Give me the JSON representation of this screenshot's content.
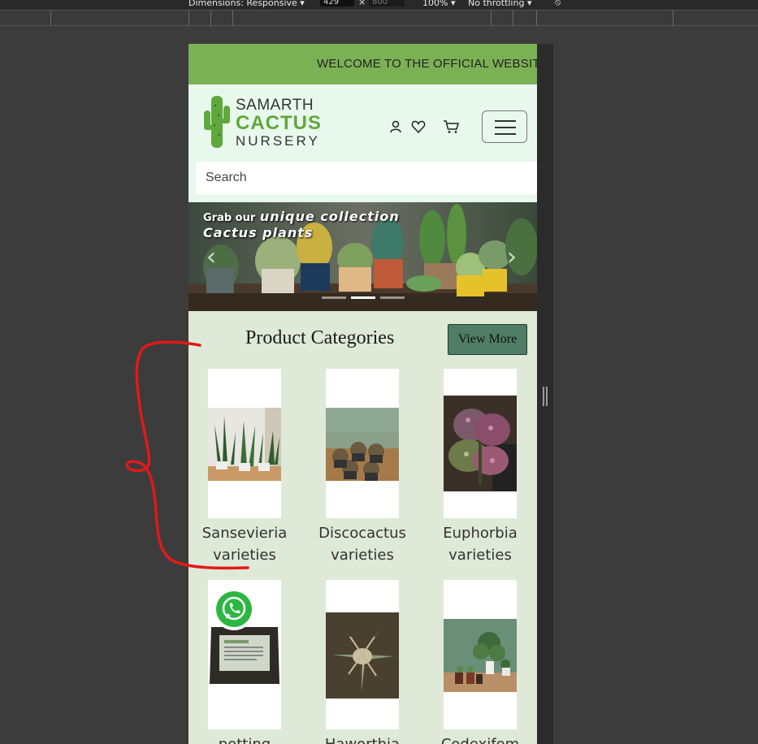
{
  "devtools": {
    "dimensions_label": "Dimensions: Responsive",
    "width_value": "429",
    "height_value": "800",
    "zoom_label": "100%",
    "throttle_label": "No throttling"
  },
  "site": {
    "marquee": "WELCOME TO THE OFFICIAL WEBSITE",
    "logo": {
      "line1": "SAMARTH",
      "line2": "CACTUS",
      "line3": "NURSERY"
    },
    "search_placeholder": "Search",
    "banner": {
      "line1a": "Grab our",
      "line1b": "unique collection",
      "line2": "Cactus plants"
    },
    "categories_title": "Product Categories",
    "view_more_label": "View More",
    "categories": [
      {
        "label": "Sansevieria varieties"
      },
      {
        "label": "Discocactus varieties"
      },
      {
        "label": "Euphorbia varieties"
      },
      {
        "label": "potting"
      },
      {
        "label": "Haworthia"
      },
      {
        "label": "Codexifom"
      }
    ]
  },
  "colors": {
    "marquee_bg": "#7bb155",
    "header_bg": "#e9f8ec",
    "page_bg": "#dfe9d8",
    "view_more_bg": "#4f7d65",
    "brand_green": "#5fa83b",
    "annotation_red": "#e01a1a"
  },
  "icons": [
    "user-icon",
    "heart-icon",
    "cart-icon",
    "hamburger-icon",
    "chevron-left-icon",
    "chevron-right-icon",
    "whatsapp-icon",
    "cactus-logo-icon"
  ]
}
